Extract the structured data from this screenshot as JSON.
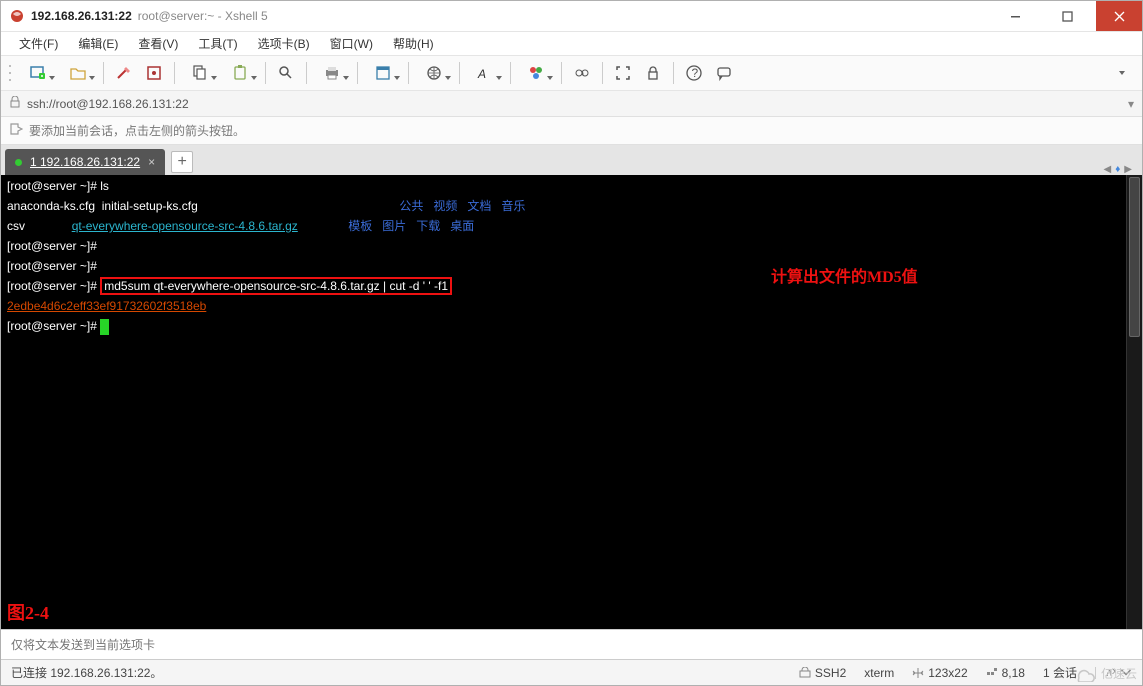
{
  "title": {
    "ip": "192.168.26.131:22",
    "full": "root@server:~ - Xshell 5"
  },
  "menu": {
    "file": "文件(F)",
    "edit": "编辑(E)",
    "view": "查看(V)",
    "tools": "工具(T)",
    "tabs": "选项卡(B)",
    "window": "窗口(W)",
    "help": "帮助(H)"
  },
  "addressbar": {
    "url": "ssh://root@192.168.26.131:22"
  },
  "hint": {
    "text": "要添加当前会话，点击左侧的箭头按钮。"
  },
  "tab": {
    "label": "1 192.168.26.131:22",
    "close": "×",
    "add": "+"
  },
  "terminal": {
    "p1": "[root@server ~]# ",
    "cmd1": "ls",
    "line2a": "anaconda-ks.cfg  initial-setup-ks.cfg",
    "dirs1": "公共   视频   文档   音乐",
    "line3a": "csv              ",
    "file_qt": "qt-everywhere-opensource-src-4.8.6.tar.gz",
    "dirs2": "模板   图片   下载   桌面",
    "p2": "[root@server ~]# ",
    "p3": "[root@server ~]# ",
    "p4": "[root@server ~]# ",
    "cmd_md5": "md5sum qt-everywhere-opensource-src-4.8.6.tar.gz | cut -d ' ' -f1",
    "annotation": "计算出文件的MD5值",
    "md5_out": "2edbe4d6c2eff33ef91732602f3518eb",
    "p5": "[root@server ~]# ",
    "figure": "图2-4"
  },
  "bottominput": {
    "placeholder": "仅将文本发送到当前选项卡"
  },
  "status": {
    "connected": "已连接 192.168.26.131:22。",
    "ssh": "SSH2",
    "term": "xterm",
    "size": "123x22",
    "pos": "8,18",
    "sess": "1 会话"
  },
  "watermark": {
    "text": "亿速云"
  }
}
